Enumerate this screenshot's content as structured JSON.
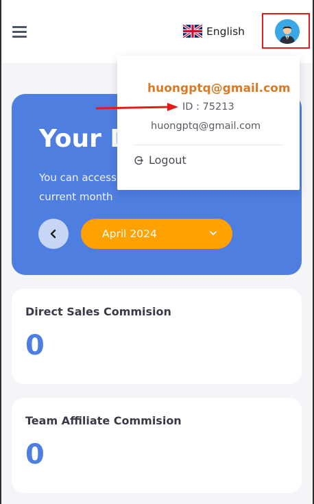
{
  "header": {
    "menu_icon": "hamburger-menu-icon",
    "language": {
      "flag_icon": "uk-flag-icon",
      "label": "English"
    },
    "avatar_icon": "user-avatar-icon"
  },
  "hero": {
    "title": "Your D",
    "description": "You can access current month",
    "description_line1": "You can access",
    "description_line2": "current month",
    "prev_icon": "chevron-left-icon",
    "month_value": "April 2024",
    "dropdown_icon": "chevron-down-icon",
    "background_color": "#4f7ee1",
    "select_color": "#ffa100"
  },
  "cards": [
    {
      "title": "Direct Sales Commision",
      "value": "0"
    },
    {
      "title": "Team Affiliate Commision",
      "value": "0"
    }
  ],
  "user_menu": {
    "email_highlight": "huongptq@gmail.com",
    "id_text": "ID : 75213",
    "email": "huongptq@gmail.com",
    "logout_icon": "logout-icon",
    "logout_label": "Logout",
    "highlight_color": "#d97a25"
  },
  "annotations": {
    "highlight_box_color": "#e31b1b",
    "arrow_color": "#e31b1b"
  }
}
